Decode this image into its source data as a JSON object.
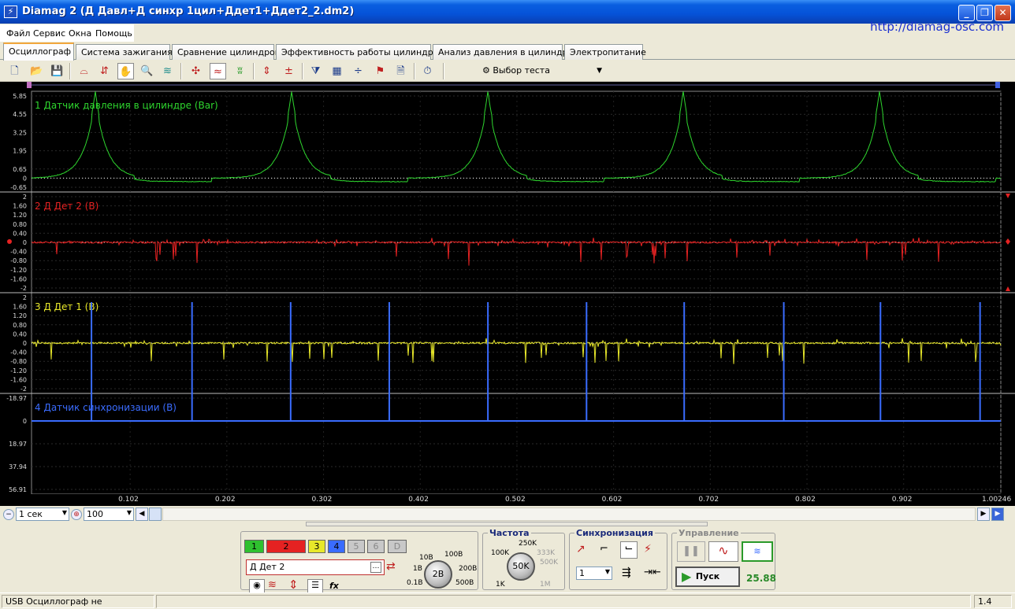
{
  "window": {
    "title": "Diamag 2 (Д Давл+Д синхр 1цил+Ддет1+Ддет2_2.dm2)",
    "url": "http://diamag-osc.com"
  },
  "menu": [
    "Файл",
    "Сервис",
    "Окна",
    "Помощь"
  ],
  "tabs": [
    {
      "label": "Осциллограф",
      "active": true
    },
    {
      "label": "Система зажигания"
    },
    {
      "label": "Сравнение цилиндров"
    },
    {
      "label": "Эффективность работы цилиндров"
    },
    {
      "label": "Анализ давления в цилиндре"
    },
    {
      "label": "Электропитание"
    }
  ],
  "toolbar": {
    "icons": [
      "new-file-icon",
      "open-folder-icon",
      "save-icon",
      "cursor-range-icon",
      "cursor-measure-icon",
      "hand-pan-icon",
      "zoom-icon",
      "channel-align-icon",
      "spread-icon",
      "overlay-icon",
      "stack-icon",
      "auto-scale-icon",
      "zero-icon",
      "filter-icon",
      "table-icon",
      "divide-icon",
      "marker-icon",
      "note-icon",
      "auto-timer-icon"
    ],
    "test_select": "Выбор теста"
  },
  "scope": {
    "channels": [
      {
        "label": "1 Датчик давления в цилиндре (Bar)",
        "color": "#2ed62e",
        "scale": [
          "5.85",
          "4.55",
          "3.25",
          "1.95",
          "0.65",
          "0",
          "-0.65"
        ]
      },
      {
        "label": "2 Д Дет 2 (В)",
        "color": "#e52222",
        "scale": [
          "2",
          "1.60",
          "1.20",
          "0.80",
          "0.40",
          "0",
          "-0.40",
          "-0.80",
          "-1.20",
          "-1.60",
          "-2"
        ]
      },
      {
        "label": "3 Д Дет 1 (В)",
        "color": "#e8e82a",
        "scale": [
          "2",
          "1.60",
          "1.20",
          "0.80",
          "0.40",
          "0",
          "-0.40",
          "-0.80",
          "-1.20",
          "-1.60",
          "-2"
        ]
      },
      {
        "label": "4 Датчик синхронизации (В)",
        "color": "#3a6cff",
        "scale": [
          "-18.97",
          "0",
          "18.97",
          "37.94",
          "56.91"
        ]
      }
    ],
    "x_ticks": [
      "0.102",
      "0.202",
      "0.302",
      "0.402",
      "0.502",
      "0.602",
      "0.702",
      "0.802",
      "0.902",
      "1.00246"
    ],
    "pressure_peaks_s": [
      0.066,
      0.269,
      0.472,
      0.674,
      0.877
    ],
    "sync_spikes_s": [
      0.062,
      0.166,
      0.268,
      0.37,
      0.472,
      0.574,
      0.675,
      0.778,
      0.878,
      0.981
    ]
  },
  "scrollbar": {
    "timebase": "1 сек",
    "zoom": "100"
  },
  "channel_panel": {
    "buttons": [
      {
        "label": "1",
        "color": "#2fc02f"
      },
      {
        "label": "2",
        "color": "#e52222"
      },
      {
        "label": "3",
        "color": "#e8e82a"
      },
      {
        "label": "4",
        "color": "#3a6cff"
      },
      {
        "label": "5",
        "color": "#c8c8c8"
      },
      {
        "label": "6",
        "color": "#c8c8c8"
      },
      {
        "label": "D",
        "color": "#c8c8c8"
      }
    ],
    "name_value": "Д Дет 2",
    "knob_labels": [
      "10В",
      "100В",
      "1В",
      "200В",
      "0.1В",
      "500В"
    ],
    "knob_value": "2В"
  },
  "frequency": {
    "title": "Частота",
    "labels": [
      "250K",
      "100K",
      "333K",
      "500K",
      "1K",
      "1M"
    ],
    "value": "50K"
  },
  "sync": {
    "title": "Синхронизация",
    "select": "1"
  },
  "control": {
    "title": "Управление",
    "start": "Пуск",
    "value": "25.88"
  },
  "status": {
    "message": "USB Осциллограф не подключен",
    "version": "1.4"
  }
}
